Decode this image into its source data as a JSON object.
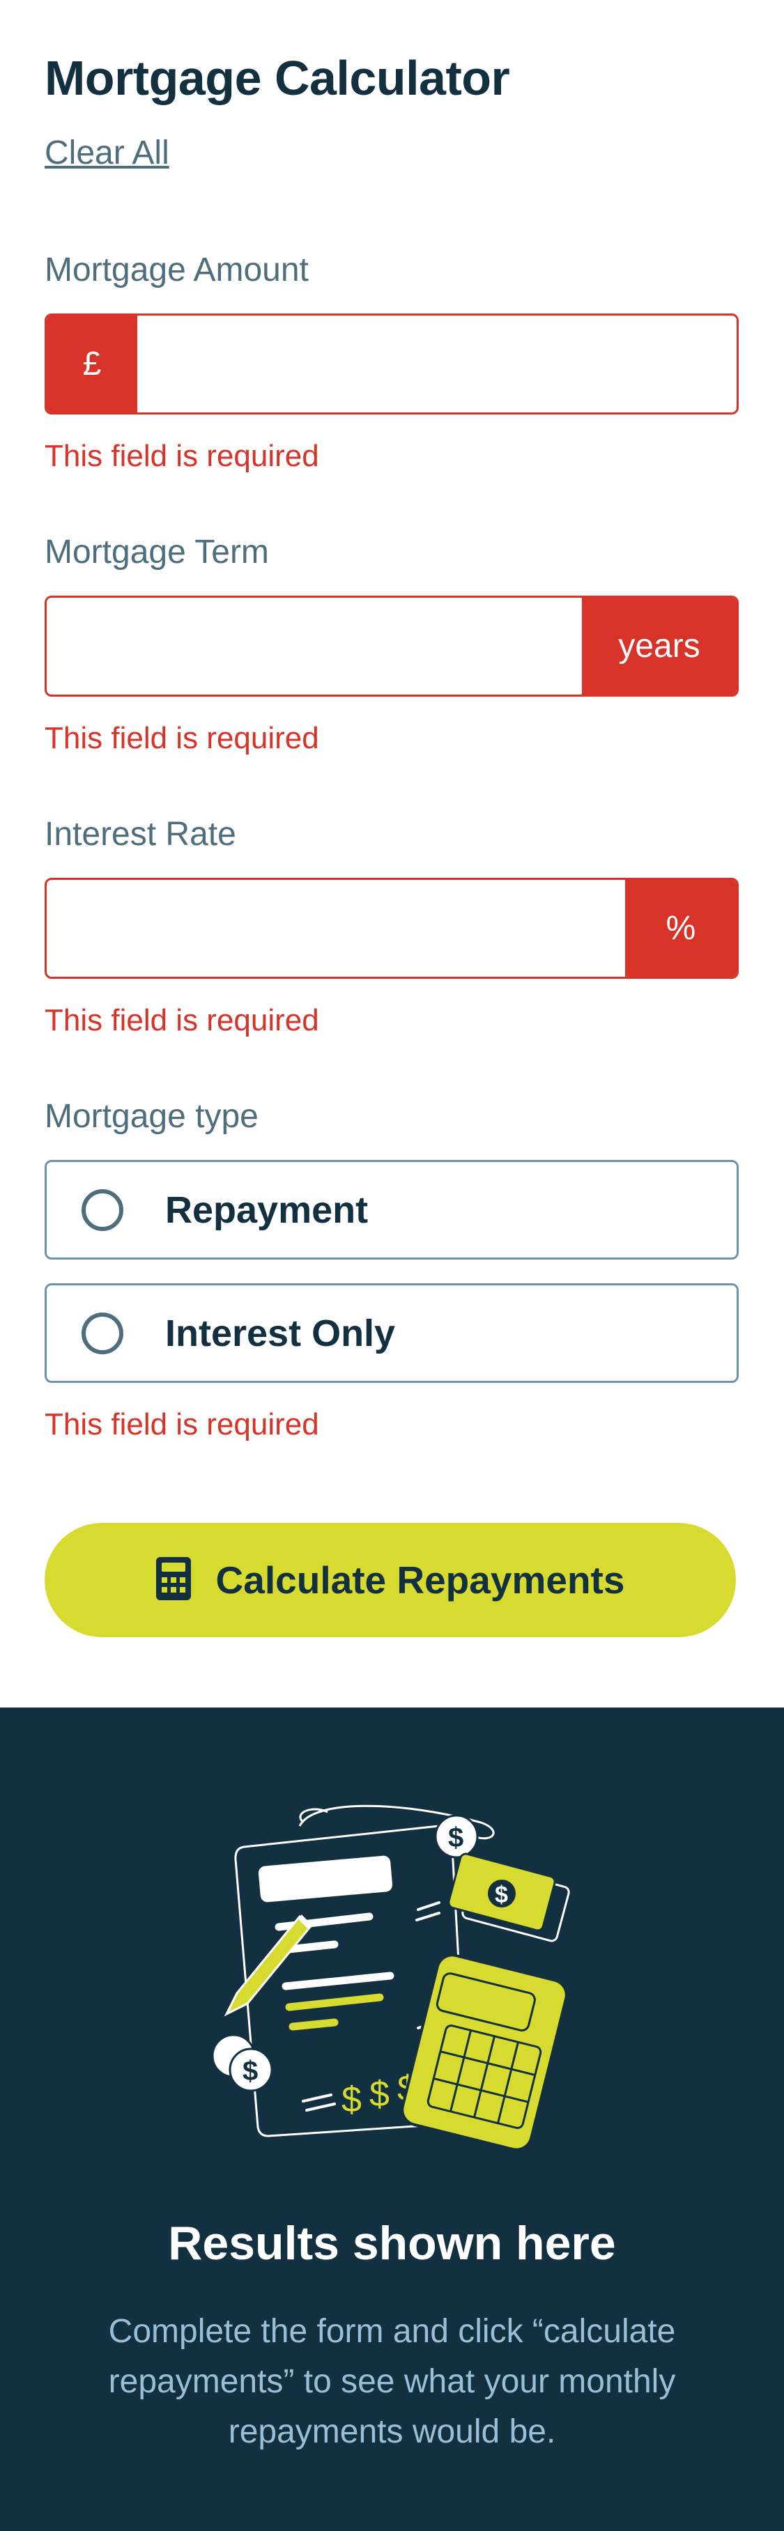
{
  "header": {
    "title": "Mortgage Calculator",
    "clear_label": "Clear All"
  },
  "fields": {
    "amount": {
      "label": "Mortgage Amount",
      "prefix": "£",
      "value": "",
      "error": "This field is required"
    },
    "term": {
      "label": "Mortgage Term",
      "suffix": "years",
      "value": "",
      "error": "This field is required"
    },
    "rate": {
      "label": "Interest Rate",
      "suffix": "%",
      "value": "",
      "error": "This field is required"
    }
  },
  "mortgage_type": {
    "label": "Mortgage type",
    "options": [
      {
        "label": "Repayment",
        "selected": false
      },
      {
        "label": "Interest Only",
        "selected": false
      }
    ],
    "error": "This field is required"
  },
  "calculate_button": {
    "label": "Calculate Repayments",
    "icon": "calculator-icon"
  },
  "results": {
    "illustration": "empty-results-illustration",
    "title": "Results shown here",
    "text": "Complete the form and click “calculate repayments” to see what your monthly repayments would be."
  },
  "colors": {
    "error": "#d73328",
    "lime": "#d8db2f",
    "dark": "#133041",
    "slate": "#4e6e7e",
    "muted_blue": "#9abed5"
  }
}
